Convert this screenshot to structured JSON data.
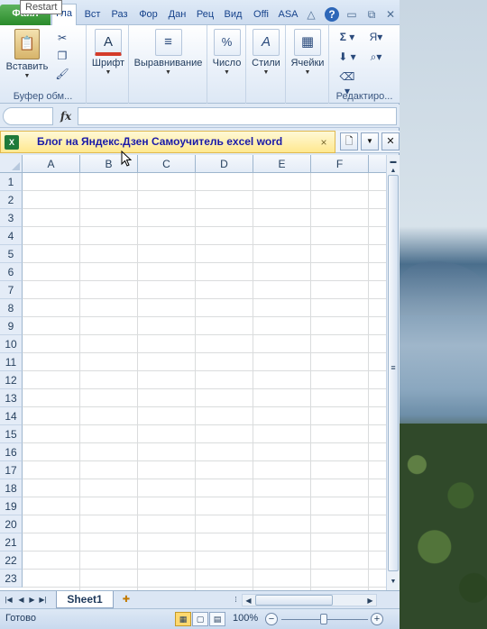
{
  "tooltip": "Restart",
  "file_tab": "Файл",
  "tabs": [
    "Гла",
    "Вст",
    "Раз",
    "Фор",
    "Дан",
    "Рец",
    "Вид",
    "Offi",
    "ASA"
  ],
  "title_buttons": {
    "collapse": "△",
    "help": "?",
    "minimize": "▭",
    "restore": "⧉",
    "close": "✕"
  },
  "ribbon": {
    "clipboard": {
      "paste_label": "Вставить",
      "group_label": "Буфер обм..."
    },
    "font": {
      "label": "Шрифт"
    },
    "alignment": {
      "label": "Выравнивание"
    },
    "number": {
      "label": "Число"
    },
    "styles": {
      "label": "Стили"
    },
    "cells": {
      "label": "Ячейки"
    },
    "editing": {
      "group_label": "Редактиро..."
    }
  },
  "formula_bar": {
    "fx": "fx",
    "value": ""
  },
  "workbook": {
    "title": "Блог на Яндекс.Дзен Самоучитель excel word",
    "close": "×"
  },
  "columns": [
    "A",
    "B",
    "C",
    "D",
    "E",
    "F"
  ],
  "rows": [
    "1",
    "2",
    "3",
    "4",
    "5",
    "6",
    "7",
    "8",
    "9",
    "10",
    "11",
    "12",
    "13",
    "14",
    "15",
    "16",
    "17",
    "18",
    "19",
    "20",
    "21",
    "22",
    "23"
  ],
  "sheets": [
    "Sheet1"
  ],
  "status": {
    "ready": "Готово",
    "zoom": "100%"
  },
  "colors": {
    "file_tab": "#2a8b2a",
    "workbook_title": "#1a1aa8",
    "workbook_tab_bg": "#ffe88f"
  }
}
